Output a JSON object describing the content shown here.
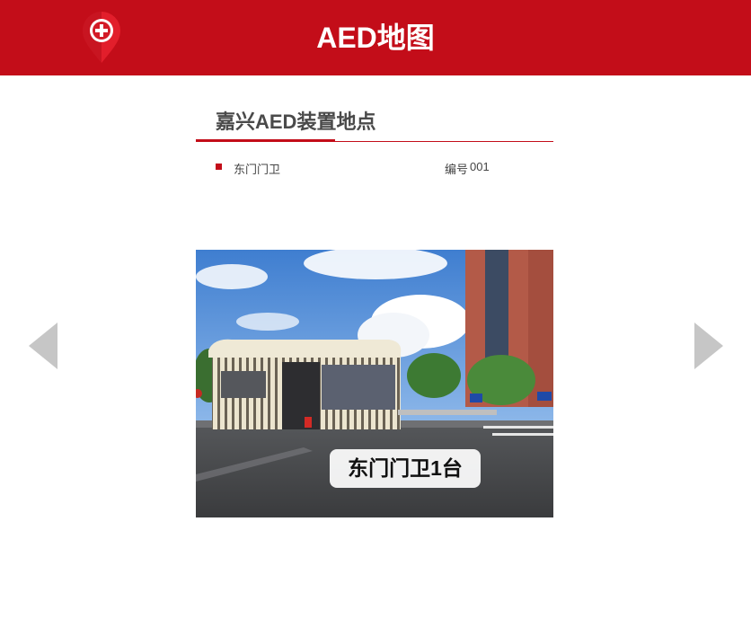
{
  "header": {
    "title": "AED地图",
    "logo_icon": "map-pin-medical-cross-icon",
    "brand_color": "#c30d19"
  },
  "section": {
    "title": "嘉兴AED装置地点"
  },
  "location": {
    "name": "东门门卫",
    "number_label": "编号",
    "number_value": "001"
  },
  "photo": {
    "caption": "东门门卫1台"
  },
  "nav": {
    "prev_icon": "triangle-left-icon",
    "next_icon": "triangle-right-icon",
    "arrow_color": "#c6c6c6"
  }
}
